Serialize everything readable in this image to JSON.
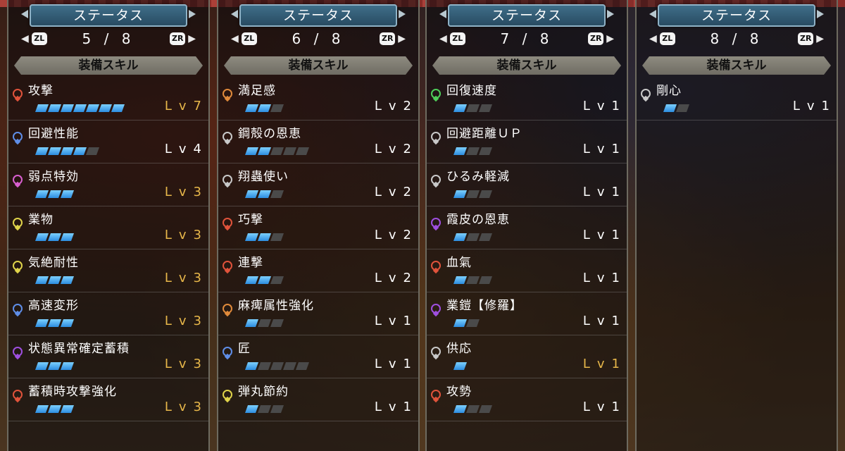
{
  "panels": [
    {
      "title": "ステータス",
      "page": "5 / 8",
      "prev_button": "ZL",
      "next_button": "ZR",
      "section": "装備スキル",
      "skills": [
        {
          "name": "攻撃",
          "level_text": "Lv",
          "level": "7",
          "filled": 7,
          "max": 7,
          "color": "#e0533b",
          "maxed": true
        },
        {
          "name": "回避性能",
          "level_text": "Lv",
          "level": "4",
          "filled": 4,
          "max": 5,
          "color": "#5f8ee8",
          "maxed": false
        },
        {
          "name": "弱点特効",
          "level_text": "Lv",
          "level": "3",
          "filled": 3,
          "max": 3,
          "color": "#d95fd0",
          "maxed": true
        },
        {
          "name": "業物",
          "level_text": "Lv",
          "level": "3",
          "filled": 3,
          "max": 3,
          "color": "#e0d34a",
          "maxed": true
        },
        {
          "name": "気絶耐性",
          "level_text": "Lv",
          "level": "3",
          "filled": 3,
          "max": 3,
          "color": "#e0d34a",
          "maxed": true
        },
        {
          "name": "高速変形",
          "level_text": "Lv",
          "level": "3",
          "filled": 3,
          "max": 3,
          "color": "#5f8ee8",
          "maxed": true
        },
        {
          "name": "状態異常確定蓄積",
          "level_text": "Lv",
          "level": "3",
          "filled": 3,
          "max": 3,
          "color": "#9f4fe0",
          "maxed": true
        },
        {
          "name": "蓄積時攻撃強化",
          "level_text": "Lv",
          "level": "3",
          "filled": 3,
          "max": 3,
          "color": "#e0533b",
          "maxed": true
        }
      ]
    },
    {
      "title": "ステータス",
      "page": "6 / 8",
      "prev_button": "ZL",
      "next_button": "ZR",
      "section": "装備スキル",
      "skills": [
        {
          "name": "満足感",
          "level_text": "Lv",
          "level": "2",
          "filled": 2,
          "max": 3,
          "color": "#e08a3b",
          "maxed": false
        },
        {
          "name": "鋼殻の恩恵",
          "level_text": "Lv",
          "level": "2",
          "filled": 2,
          "max": 5,
          "color": "#c9c9c9",
          "maxed": false
        },
        {
          "name": "翔蟲使い",
          "level_text": "Lv",
          "level": "2",
          "filled": 2,
          "max": 3,
          "color": "#c9c9c9",
          "maxed": false
        },
        {
          "name": "巧撃",
          "level_text": "Lv",
          "level": "2",
          "filled": 2,
          "max": 3,
          "color": "#e0533b",
          "maxed": false
        },
        {
          "name": "連撃",
          "level_text": "Lv",
          "level": "2",
          "filled": 2,
          "max": 3,
          "color": "#e0533b",
          "maxed": false
        },
        {
          "name": "麻痺属性強化",
          "level_text": "Lv",
          "level": "1",
          "filled": 1,
          "max": 3,
          "color": "#e08a3b",
          "maxed": false
        },
        {
          "name": "匠",
          "level_text": "Lv",
          "level": "1",
          "filled": 1,
          "max": 5,
          "color": "#5f8ee8",
          "maxed": false
        },
        {
          "name": "弾丸節約",
          "level_text": "Lv",
          "level": "1",
          "filled": 1,
          "max": 3,
          "color": "#e0d34a",
          "maxed": false
        }
      ]
    },
    {
      "title": "ステータス",
      "page": "7 / 8",
      "prev_button": "ZL",
      "next_button": "ZR",
      "section": "装備スキル",
      "skills": [
        {
          "name": "回復速度",
          "level_text": "Lv",
          "level": "1",
          "filled": 1,
          "max": 3,
          "color": "#4fcf5a",
          "maxed": false
        },
        {
          "name": "回避距離ＵＰ",
          "level_text": "Lv",
          "level": "1",
          "filled": 1,
          "max": 3,
          "color": "#c9c9c9",
          "maxed": false
        },
        {
          "name": "ひるみ軽減",
          "level_text": "Lv",
          "level": "1",
          "filled": 1,
          "max": 3,
          "color": "#c9c9c9",
          "maxed": false
        },
        {
          "name": "霞皮の恩恵",
          "level_text": "Lv",
          "level": "1",
          "filled": 1,
          "max": 3,
          "color": "#9f4fe0",
          "maxed": false
        },
        {
          "name": "血氣",
          "level_text": "Lv",
          "level": "1",
          "filled": 1,
          "max": 3,
          "color": "#e0533b",
          "maxed": false
        },
        {
          "name": "業鎧【修羅】",
          "level_text": "Lv",
          "level": "1",
          "filled": 1,
          "max": 2,
          "color": "#9f4fe0",
          "maxed": false
        },
        {
          "name": "供応",
          "level_text": "Lv",
          "level": "1",
          "filled": 1,
          "max": 1,
          "color": "#c9c9c9",
          "maxed": true
        },
        {
          "name": "攻勢",
          "level_text": "Lv",
          "level": "1",
          "filled": 1,
          "max": 3,
          "color": "#e0533b",
          "maxed": false
        }
      ]
    },
    {
      "title": "ステータス",
      "page": "8 / 8",
      "prev_button": "ZL",
      "next_button": "ZR",
      "section": "装備スキル",
      "skills": [
        {
          "name": "剛心",
          "level_text": "Lv",
          "level": "1",
          "filled": 1,
          "max": 2,
          "color": "#c9c9c9",
          "maxed": false
        }
      ]
    }
  ]
}
